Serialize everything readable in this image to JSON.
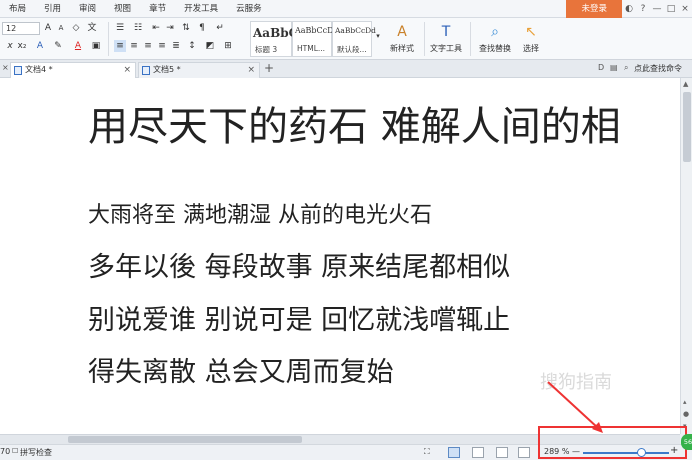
{
  "menu": {
    "items": [
      "布局",
      "引用",
      "审阅",
      "视图",
      "章节",
      "开发工具",
      "云服务"
    ],
    "login": "未登录",
    "controls": [
      "?",
      "—",
      "□",
      "×"
    ]
  },
  "ribbon": {
    "font_size": "12",
    "styles": [
      {
        "sample": "AaBbC",
        "caption": "标题 3"
      },
      {
        "sample": "AaBbCcD",
        "caption": "HTML..."
      },
      {
        "sample": "AaBbCcDd",
        "caption": "默认段..."
      }
    ],
    "buttons": {
      "new_style": "新样式",
      "text_tools": "文字工具",
      "find_replace": "查找替换",
      "select": "选择"
    }
  },
  "tabs": [
    {
      "label": "文档4 *"
    },
    {
      "label": "文档5 *"
    }
  ],
  "tabbar": {
    "find_command": "点此查找命令",
    "new_tab": "+"
  },
  "document": {
    "title_line": "用尽天下的药石  难解人间的相",
    "lines": [
      "大雨将至  满地潮湿  从前的电光火石",
      "多年以後  每段故事  原来结尾都相似",
      "别说爱谁  别说可是  回忆就浅嚐辄止",
      "得失离散  总会又周而复始"
    ]
  },
  "statusbar": {
    "page_count": "70",
    "spell_check": "拼写检查",
    "zoom": "289 %",
    "zoom_minus": "—",
    "zoom_plus": "+"
  },
  "watermark": {
    "text": "搜狗指南"
  },
  "badge": "56",
  "colors": {
    "login_bg": "#e8743b",
    "highlight": "#e33333",
    "zoom_accent": "#3b79c9"
  }
}
